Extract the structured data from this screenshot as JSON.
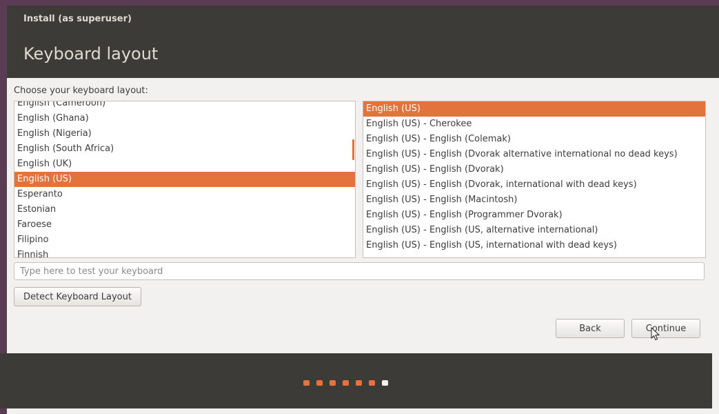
{
  "window": {
    "title": "Install (as superuser)",
    "page_title": "Keyboard layout"
  },
  "layout_picker": {
    "prompt": "Choose your keyboard layout:",
    "languages": [
      {
        "label": "English (Cameroon)",
        "selected": false
      },
      {
        "label": "English (Ghana)",
        "selected": false
      },
      {
        "label": "English (Nigeria)",
        "selected": false
      },
      {
        "label": "English (South Africa)",
        "selected": false
      },
      {
        "label": "English (UK)",
        "selected": false
      },
      {
        "label": "English (US)",
        "selected": true
      },
      {
        "label": "Esperanto",
        "selected": false
      },
      {
        "label": "Estonian",
        "selected": false
      },
      {
        "label": "Faroese",
        "selected": false
      },
      {
        "label": "Filipino",
        "selected": false
      },
      {
        "label": "Finnish",
        "selected": false
      }
    ],
    "variants": [
      {
        "label": "English (US)",
        "selected": true
      },
      {
        "label": "English (US) - Cherokee",
        "selected": false
      },
      {
        "label": "English (US) - English (Colemak)",
        "selected": false
      },
      {
        "label": "English (US) - English (Dvorak alternative international no dead keys)",
        "selected": false
      },
      {
        "label": "English (US) - English (Dvorak)",
        "selected": false
      },
      {
        "label": "English (US) - English (Dvorak, international with dead keys)",
        "selected": false
      },
      {
        "label": "English (US) - English (Macintosh)",
        "selected": false
      },
      {
        "label": "English (US) - English (Programmer Dvorak)",
        "selected": false
      },
      {
        "label": "English (US) - English (US, alternative international)",
        "selected": false
      },
      {
        "label": "English (US) - English (US, international with dead keys)",
        "selected": false
      }
    ]
  },
  "test_input": {
    "placeholder": "Type here to test your keyboard",
    "value": ""
  },
  "buttons": {
    "detect_label": "Detect Keyboard Layout",
    "back_label": "Back",
    "continue_label": "Continue"
  },
  "progress": {
    "total_steps": 7,
    "current_step": 7
  },
  "colors": {
    "accent": "#e2733c",
    "header_bg": "#3c3b37",
    "window_bg": "#f2f1f0"
  }
}
